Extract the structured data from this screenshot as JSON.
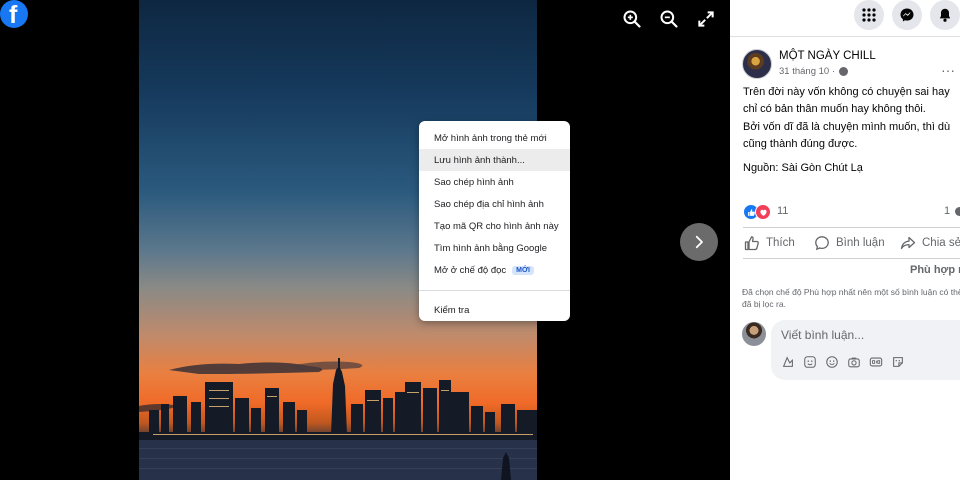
{
  "brand": {
    "logo_letter": "f"
  },
  "viewer": {
    "tools": [
      {
        "name": "zoom-in-icon"
      },
      {
        "name": "zoom-out-icon"
      },
      {
        "name": "fullscreen-icon"
      }
    ]
  },
  "context_menu": {
    "items": [
      {
        "label": "Mở hình ảnh trong thẻ mới"
      },
      {
        "label": "Lưu hình ảnh thành...",
        "highlighted": true
      },
      {
        "label": "Sao chép hình ảnh"
      },
      {
        "label": "Sao chép địa chỉ hình ảnh"
      },
      {
        "label": "Tạo mã QR cho hình ảnh này"
      },
      {
        "label": "Tìm hình ảnh bằng Google"
      },
      {
        "label": "Mở ở chế độ đọc",
        "badge": "MỚI"
      }
    ],
    "inspect": "Kiểm tra"
  },
  "post": {
    "author": "MỘT NGÀY CHILL",
    "date": "31 tháng 10 ·",
    "text_lines": [
      "Trên đời này vốn không có chuyện sai hay",
      "chỉ có bản thân muốn hay không thôi.",
      "Bởi vốn dĩ đã là chuyện mình muốn, thì dù",
      "cũng thành đúng được."
    ],
    "source": "Nguồn: Sài Gòn Chút Lạ",
    "reactions_count": "11",
    "comments_count": "1",
    "actions": {
      "like": "Thích",
      "comment": "Bình luận",
      "share": "Chia sẻ"
    }
  },
  "comments": {
    "sort_label": "Phù hợp n",
    "sort_note": "Đã chọn chế độ Phù hợp nhất nên một số bình luận có thể đã bị lọc ra.",
    "input_placeholder": "Viết bình luận..."
  },
  "colors": {
    "brand_blue": "#1877f2",
    "love_red": "#f33e58",
    "badge_bg": "#d6e4fb",
    "badge_text": "#1a56c4"
  }
}
